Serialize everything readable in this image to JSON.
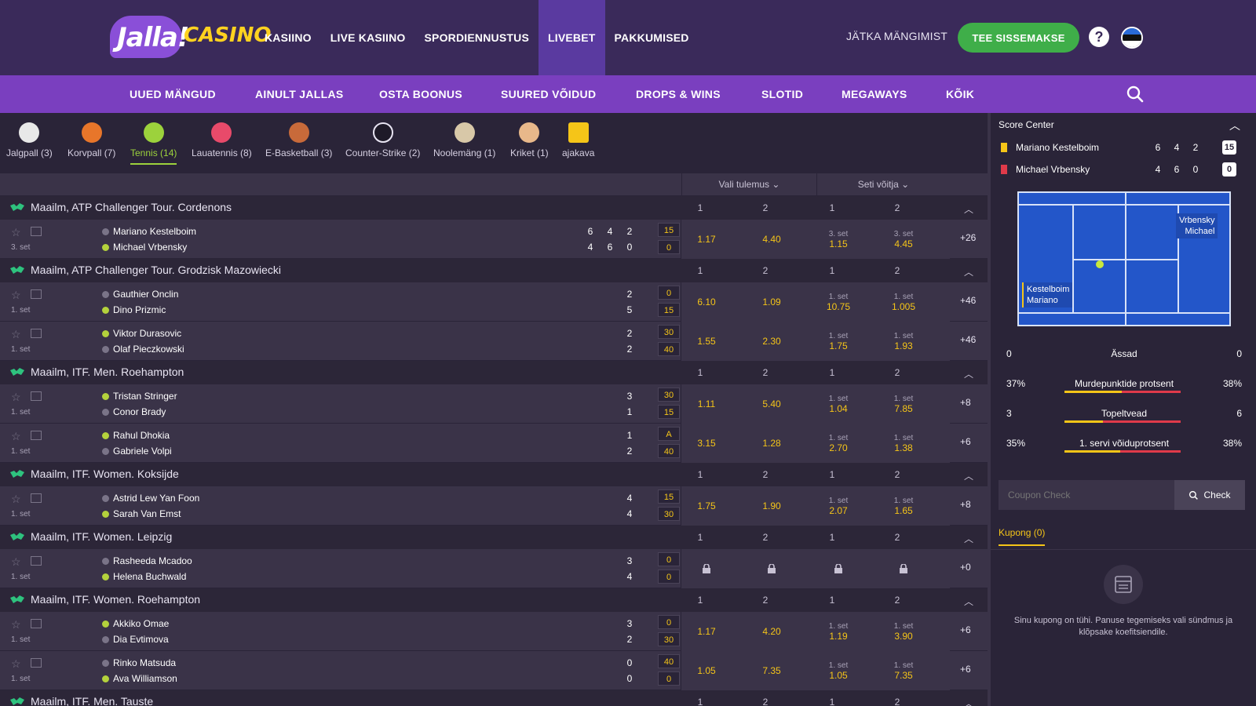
{
  "header": {
    "logo_text": "Jalla!",
    "logo_word": "CASINO",
    "nav": [
      "KASIINO",
      "LIVE KASIINO",
      "SPORDIENNUSTUS",
      "LIVEBET",
      "PAKKUMISED"
    ],
    "active_nav": "LIVEBET",
    "continue_label": "JÄTKA MÄNGIMIST",
    "deposit_label": "TEE SISSEMAKSE",
    "help_icon": "?",
    "flag": "estonia-flag-icon"
  },
  "subnav": [
    "UUED MÄNGUD",
    "AINULT JALLAS",
    "OSTA BOONUS",
    "SUURED VÕIDUD",
    "DROPS & WINS",
    "SLOTID",
    "MEGAWAYS",
    "KÕIK"
  ],
  "sports": [
    {
      "label": "Jalgpall (3)",
      "icon": "soccer-ball-icon",
      "color": "#e8e8e8"
    },
    {
      "label": "Korvpall (7)",
      "icon": "basketball-icon",
      "color": "#e8762a"
    },
    {
      "label": "Tennis (14)",
      "icon": "tennis-ball-icon",
      "color": "#9cd23c",
      "active": true
    },
    {
      "label": "Lauatennis (8)",
      "icon": "table-tennis-icon",
      "color": "#e84a6a"
    },
    {
      "label": "E-Basketball (3)",
      "icon": "e-basketball-icon",
      "color": "#c86a3a"
    },
    {
      "label": "Counter-Strike (2)",
      "icon": "counter-strike-icon",
      "color": "#1e1a28"
    },
    {
      "label": "Noolemäng (1)",
      "icon": "darts-icon",
      "color": "#d8c8a8"
    },
    {
      "label": "Kriket (1)",
      "icon": "cricket-icon",
      "color": "#e8b88a"
    },
    {
      "label": "ajakava",
      "icon": "calendar-icon",
      "color": "#f5c518"
    }
  ],
  "market_header": {
    "result_select": "Vali tulemus",
    "set_winner_select": "Seti võitja"
  },
  "leagues": [
    {
      "name": "Maailm, ATP Challenger Tour. Cordenons",
      "cols": [
        "1",
        "2",
        "1",
        "2"
      ],
      "events": [
        {
          "set": "3. set",
          "p1": "Mariano Kestelboim",
          "p2": "Michael Vrbensky",
          "serve": 2,
          "s1": [
            "6",
            "4",
            "2"
          ],
          "s2": [
            "4",
            "6",
            "0"
          ],
          "pt1": "15",
          "pt2": "0",
          "odds": [
            {
              "v": "1.17"
            },
            {
              "v": "4.40"
            },
            {
              "l": "3. set",
              "v": "1.15"
            },
            {
              "l": "3. set",
              "v": "4.45"
            }
          ],
          "more": "+26"
        }
      ]
    },
    {
      "name": "Maailm, ATP Challenger Tour. Grodzisk Mazowiecki",
      "cols": [
        "1",
        "2",
        "1",
        "2"
      ],
      "events": [
        {
          "set": "1. set",
          "p1": "Gauthier Onclin",
          "p2": "Dino Prizmic",
          "serve": 2,
          "s1": [
            "2"
          ],
          "s2": [
            "5"
          ],
          "pt1": "0",
          "pt2": "15",
          "odds": [
            {
              "v": "6.10"
            },
            {
              "v": "1.09"
            },
            {
              "l": "1. set",
              "v": "10.75"
            },
            {
              "l": "1. set",
              "v": "1.005"
            }
          ],
          "more": "+46"
        },
        {
          "set": "1. set",
          "p1": "Viktor Durasovic",
          "p2": "Olaf Pieczkowski",
          "serve": 1,
          "s1": [
            "2"
          ],
          "s2": [
            "2"
          ],
          "pt1": "30",
          "pt2": "40",
          "odds": [
            {
              "v": "1.55"
            },
            {
              "v": "2.30"
            },
            {
              "l": "1. set",
              "v": "1.75"
            },
            {
              "l": "1. set",
              "v": "1.93"
            }
          ],
          "more": "+46"
        }
      ]
    },
    {
      "name": "Maailm, ITF. Men. Roehampton",
      "cols": [
        "1",
        "2",
        "1",
        "2"
      ],
      "events": [
        {
          "set": "1. set",
          "p1": "Tristan Stringer",
          "p2": "Conor Brady",
          "serve": 1,
          "s1": [
            "3"
          ],
          "s2": [
            "1"
          ],
          "pt1": "30",
          "pt2": "15",
          "odds": [
            {
              "v": "1.11"
            },
            {
              "v": "5.40"
            },
            {
              "l": "1. set",
              "v": "1.04"
            },
            {
              "l": "1. set",
              "v": "7.85"
            }
          ],
          "more": "+8"
        },
        {
          "set": "1. set",
          "p1": "Rahul Dhokia",
          "p2": "Gabriele Volpi",
          "serve": 1,
          "s1": [
            "1"
          ],
          "s2": [
            "2"
          ],
          "pt1": "A",
          "pt2": "40",
          "odds": [
            {
              "v": "3.15"
            },
            {
              "v": "1.28"
            },
            {
              "l": "1. set",
              "v": "2.70"
            },
            {
              "l": "1. set",
              "v": "1.38"
            }
          ],
          "more": "+6"
        }
      ]
    },
    {
      "name": "Maailm, ITF. Women. Koksijde",
      "cols": [
        "1",
        "2",
        "1",
        "2"
      ],
      "events": [
        {
          "set": "1. set",
          "p1": "Astrid Lew Yan Foon",
          "p2": "Sarah Van Emst",
          "serve": 2,
          "s1": [
            "4"
          ],
          "s2": [
            "4"
          ],
          "pt1": "15",
          "pt2": "30",
          "odds": [
            {
              "v": "1.75"
            },
            {
              "v": "1.90"
            },
            {
              "l": "1. set",
              "v": "2.07"
            },
            {
              "l": "1. set",
              "v": "1.65"
            }
          ],
          "more": "+8"
        }
      ]
    },
    {
      "name": "Maailm, ITF. Women. Leipzig",
      "cols": [
        "1",
        "2",
        "1",
        "2"
      ],
      "events": [
        {
          "set": "1. set",
          "p1": "Rasheeda Mcadoo",
          "p2": "Helena Buchwald",
          "serve": 2,
          "s1": [
            "3"
          ],
          "s2": [
            "4"
          ],
          "pt1": "0",
          "pt2": "0",
          "odds": [
            {
              "lock": true
            },
            {
              "lock": true
            },
            {
              "lock": true
            },
            {
              "lock": true
            }
          ],
          "more": "+0"
        }
      ]
    },
    {
      "name": "Maailm, ITF. Women. Roehampton",
      "cols": [
        "1",
        "2",
        "1",
        "2"
      ],
      "events": [
        {
          "set": "1. set",
          "p1": "Akkiko Omae",
          "p2": "Dia Evtimova",
          "serve": 1,
          "s1": [
            "3"
          ],
          "s2": [
            "2"
          ],
          "pt1": "0",
          "pt2": "30",
          "odds": [
            {
              "v": "1.17"
            },
            {
              "v": "4.20"
            },
            {
              "l": "1. set",
              "v": "1.19"
            },
            {
              "l": "1. set",
              "v": "3.90"
            }
          ],
          "more": "+6"
        },
        {
          "set": "1. set",
          "p1": "Rinko Matsuda",
          "p2": "Ava Williamson",
          "serve": 2,
          "s1": [
            "0"
          ],
          "s2": [
            "0"
          ],
          "pt1": "40",
          "pt2": "0",
          "odds": [
            {
              "v": "1.05"
            },
            {
              "v": "7.35"
            },
            {
              "l": "1. set",
              "v": "1.05"
            },
            {
              "l": "1. set",
              "v": "7.35"
            }
          ],
          "more": "+6"
        }
      ]
    },
    {
      "name": "Maailm, ITF. Men. Tauste",
      "cols": [
        "1",
        "2",
        "1",
        "2"
      ],
      "events": []
    }
  ],
  "score_center": {
    "title": "Score Center",
    "players": [
      {
        "name": "Mariano Kestelboim",
        "sets": [
          "6",
          "4",
          "2"
        ],
        "point": "15",
        "card_color": "#f5c518"
      },
      {
        "name": "Michael Vrbensky",
        "sets": [
          "4",
          "6",
          "0"
        ],
        "point": "0",
        "card_color": "#e03a4a"
      }
    ],
    "court_labels": [
      "Vrbensky",
      "Michael",
      "Kestelboim",
      "Mariano"
    ],
    "aces": {
      "label": "Ässad",
      "left": "0",
      "right": "0"
    },
    "stats": [
      {
        "label": "Murdepunktide protsent",
        "left": "37%",
        "right": "38%",
        "share": 0.49
      },
      {
        "label": "Topeltvead",
        "left": "3",
        "right": "6",
        "share": 0.33
      },
      {
        "label": "1. servi võiduprotsent",
        "left": "35%",
        "right": "38%",
        "share": 0.48
      }
    ]
  },
  "coupon": {
    "placeholder": "Coupon Check",
    "check_label": "Check",
    "tab_label": "Kupong (0)",
    "empty_text": "Sinu kupong on tühi. Panuse tegemiseks vali sündmus ja klõpsake koefitsiendile."
  },
  "colors": {
    "header_bg": "#3a2a5a",
    "subnav_bg": "#7a3fbf",
    "accent_green": "#3fae49",
    "odds_yellow": "#f5c518",
    "tennis_green": "#9cd23c"
  }
}
